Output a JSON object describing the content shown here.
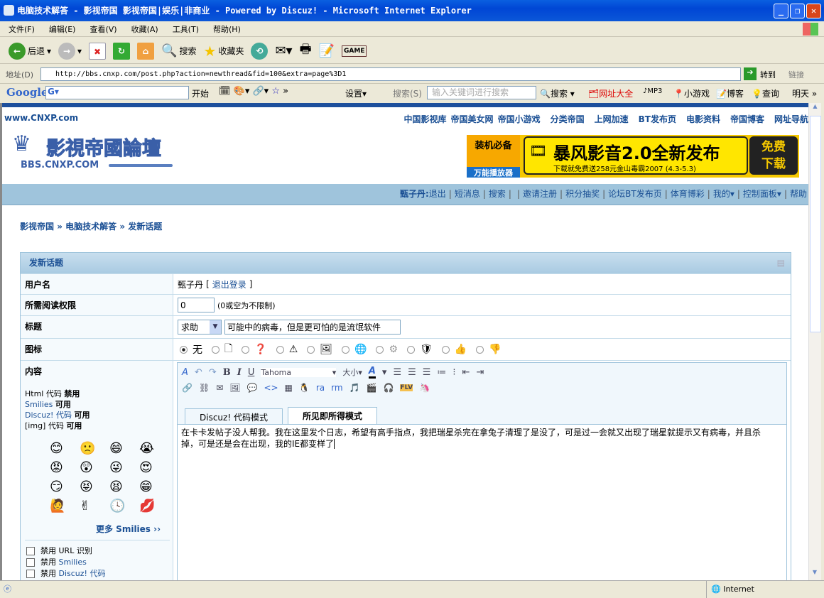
{
  "window": {
    "title": "电脑技术解答 - 影视帝国 影视帝国|娱乐|非商业 - Powered by Discuz! - Microsoft Internet Explorer"
  },
  "menu": [
    "文件(F)",
    "编辑(E)",
    "查看(V)",
    "收藏(A)",
    "工具(T)",
    "帮助(H)"
  ],
  "toolbar": {
    "back": "后退",
    "search": "搜索",
    "favorites": "收藏夹"
  },
  "address": {
    "label": "地址(D)",
    "url": "http://bbs.cnxp.com/post.php?action=newthread&fid=100&extra=page%3D1",
    "go": "转到",
    "links": "链接"
  },
  "google": {
    "brand": "Google",
    "start": "开始",
    "settings": "设置▾",
    "search_label": "搜索(S)",
    "search_placeholder": "输入关键词进行搜索",
    "search_btn": "搜索",
    "links": [
      "网址大全",
      "MP3",
      "小游戏",
      "博客",
      "查询",
      "明天"
    ]
  },
  "site": {
    "url": "www.CNXP.com",
    "logo_text": "影視帝國論壇",
    "logo_sub": "BBS.CNXP.COM",
    "toplinks": [
      "中国影视库",
      "帝国美女网",
      "帝国小游戏",
      "分类帝国",
      "上网加速",
      "BT发布页",
      "电影资料",
      "帝国博客",
      "网址导航"
    ],
    "ad": {
      "badge": "装机必备",
      "badge_sub": "万能播放器",
      "headline": "暴风影音2.0全新发布",
      "sub": "下载就免费送258元金山毒霸2007 (4.3-5.3)",
      "cta": "免费下载"
    }
  },
  "nav": {
    "user": "甄子丹:",
    "items": [
      "退出",
      "短消息",
      "搜索",
      "",
      "邀请注册",
      "积分抽奖",
      "论坛BT发布页",
      "体育博彩",
      "我的▾",
      "控制面板▾",
      "帮助"
    ]
  },
  "breadcrumb": [
    "影视帝国",
    "电脑技术解答",
    "发新话题"
  ],
  "form": {
    "title": "发新话题",
    "username_label": "用户名",
    "username": "甄子丹",
    "logout": "退出登录",
    "perm_label": "所需阅读权限",
    "perm_value": "0",
    "perm_hint": "(0或空为不限制)",
    "subject_label": "标题",
    "subject_type": "求助",
    "subject": "可能中的病毒，但是更可怕的是流氓软件",
    "icon_label": "图标",
    "icon_none": "无",
    "content_label": "内容",
    "html_code": "Html 代码",
    "html_state": "禁用",
    "smilies": "Smilies",
    "smilies_state": "可用",
    "discuz_code": "Discuz! 代码",
    "discuz_state": "可用",
    "img_code": "[img] 代码",
    "img_state": "可用",
    "smilies_list": [
      "😊",
      "🙁",
      "😄",
      "😭",
      "😡",
      "😲",
      "😜",
      "😍",
      "😏",
      "😝",
      "😫",
      "😁",
      "🙋",
      "✌",
      "🕓",
      "💋"
    ],
    "more_smilies": "更多 Smilies ››",
    "options": [
      {
        "prefix": "禁用",
        "text": "URL 识别"
      },
      {
        "prefix": "禁用",
        "text": "Smilies"
      },
      {
        "prefix": "禁用",
        "text": "Discuz! 代码"
      }
    ],
    "editor": {
      "font": "Tahoma",
      "size": "大小",
      "tab_code": "Discuz! 代码模式",
      "tab_wysiwyg": "所见即所得模式",
      "body": "在卡卡发帖子没人帮我。我在这里发个日志，希望有高手指点，我把瑞星杀完在拿兔子清理了是没了，可是过一会就又出现了瑞星就提示又有病毒，并且杀掉，可是还是会在出现，我的IE都变样了"
    }
  },
  "status": {
    "zone": "Internet"
  }
}
